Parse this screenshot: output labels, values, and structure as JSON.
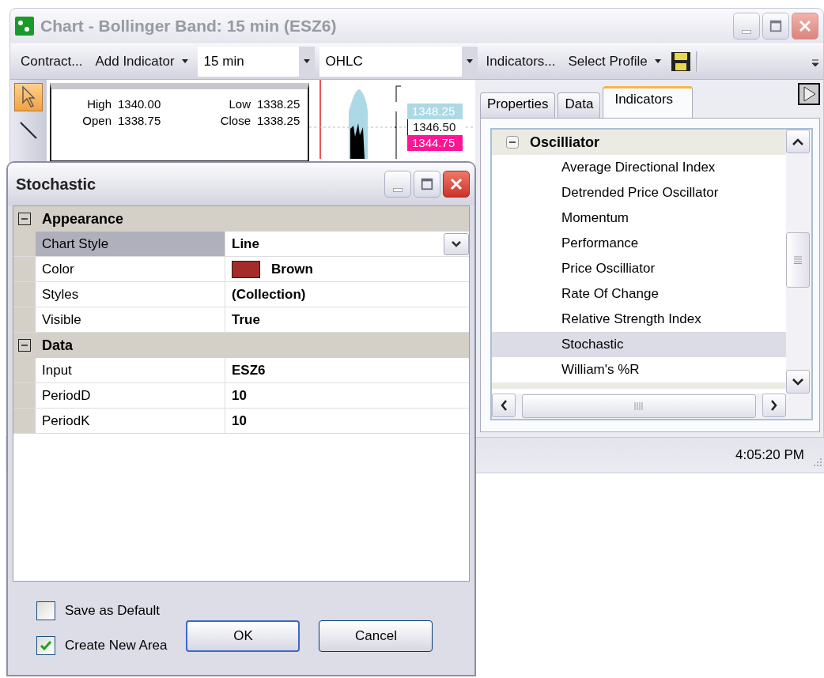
{
  "window": {
    "title": "Chart - Bollinger Band: 15 min (ESZ6)"
  },
  "toolbar": {
    "items": [
      {
        "kind": "button",
        "label": "Contract..."
      },
      {
        "kind": "menu",
        "label": "Add Indicator"
      },
      {
        "kind": "combo",
        "value": "15 min"
      },
      {
        "kind": "combo",
        "value": "OHLC"
      },
      {
        "kind": "button",
        "label": "Indicators..."
      },
      {
        "kind": "menu",
        "label": "Select Profile"
      },
      {
        "kind": "save"
      }
    ]
  },
  "tools": [
    {
      "kind": "pointer",
      "selected": true
    },
    {
      "kind": "line",
      "selected": false
    }
  ],
  "quote": {
    "rows": [
      [
        {
          "label": "High",
          "value": "1340.00"
        },
        {
          "label": "Low",
          "value": "1338.25"
        }
      ],
      [
        {
          "label": "Open",
          "value": "1338.75"
        },
        {
          "label": "Close",
          "value": "1338.25"
        }
      ]
    ]
  },
  "price_labels": [
    {
      "kind": "upper",
      "text": "1348.25"
    },
    {
      "kind": "last",
      "text": "1346.50"
    },
    {
      "kind": "lower",
      "text": "1344.75"
    }
  ],
  "panel": {
    "tabs": [
      {
        "label": "Properties",
        "selected": false
      },
      {
        "label": "Data",
        "selected": false
      },
      {
        "label": "Indicators",
        "selected": true
      }
    ],
    "tree": [
      {
        "label": "Oscilliator",
        "expanded": true,
        "children": [
          {
            "label": "Average Directional Index",
            "selected": false
          },
          {
            "label": "Detrended Price Oscillator",
            "selected": false
          },
          {
            "label": "Momentum",
            "selected": false
          },
          {
            "label": "Performance",
            "selected": false
          },
          {
            "label": "Price Oscilliator",
            "selected": false
          },
          {
            "label": "Rate Of Change",
            "selected": false
          },
          {
            "label": "Relative Strength Index",
            "selected": false
          },
          {
            "label": "Stochastic",
            "selected": true
          },
          {
            "label": "William's %R",
            "selected": false
          }
        ]
      }
    ]
  },
  "status_bar": {
    "time": "4:05:20 PM"
  },
  "dialog": {
    "title": "Stochastic",
    "categories": [
      {
        "name": "Appearance",
        "expanded": true,
        "properties": [
          {
            "kind": "dropdown",
            "name": "Chart Style",
            "value": "Line",
            "selected": true
          },
          {
            "kind": "color",
            "name": "Color",
            "value": "Brown",
            "color": "#a52a2a",
            "selected": false
          },
          {
            "kind": "text",
            "name": "Styles",
            "value": "(Collection)",
            "selected": false
          },
          {
            "kind": "text",
            "name": "Visible",
            "value": "True",
            "selected": false
          }
        ]
      },
      {
        "name": "Data",
        "expanded": true,
        "properties": [
          {
            "kind": "text",
            "name": "Input",
            "value": "ESZ6",
            "selected": false
          },
          {
            "kind": "text",
            "name": "PeriodD",
            "value": "10",
            "selected": false
          },
          {
            "kind": "text",
            "name": "PeriodK",
            "value": "10",
            "selected": false
          }
        ]
      }
    ],
    "options": [
      {
        "label": "Save as Default",
        "checked": false
      },
      {
        "label": "Create New Area",
        "checked": true
      }
    ],
    "buttons": [
      {
        "label": "OK",
        "default": true
      },
      {
        "label": "Cancel",
        "default": false
      }
    ]
  }
}
